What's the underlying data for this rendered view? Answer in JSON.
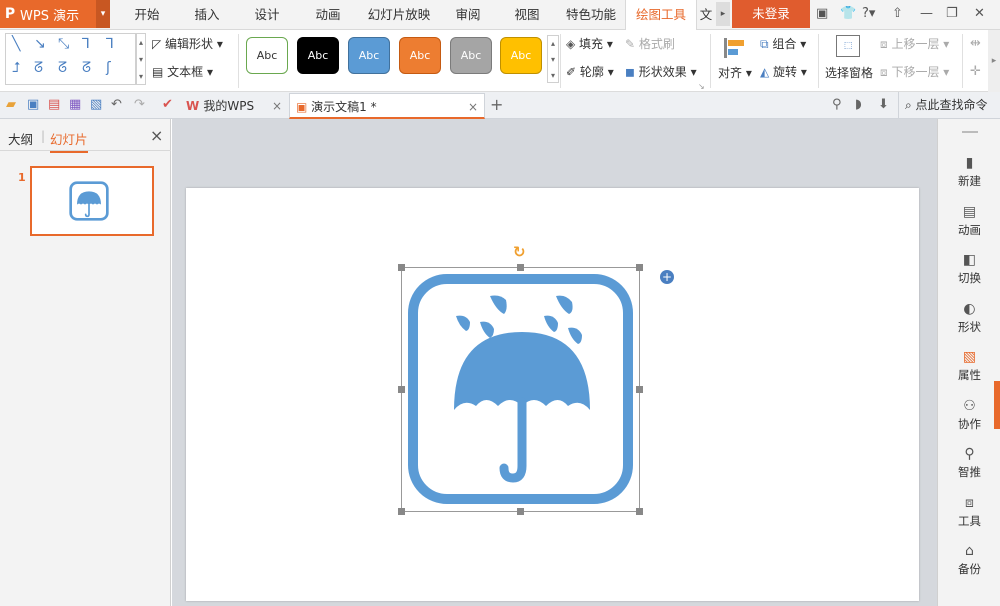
{
  "app": {
    "logo": "P",
    "name": "WPS 演示",
    "dropdown": "▾"
  },
  "menu": {
    "tabs": [
      "开始",
      "插入",
      "设计",
      "动画",
      "幻灯片放映",
      "审阅",
      "视图",
      "特色功能",
      "绘图工具",
      "文"
    ],
    "active": "绘图工具",
    "login": "未登录",
    "help": "?",
    "right_icons": [
      "archive-icon",
      "shirt-icon",
      "help-icon",
      "upload-icon",
      "minimize-icon",
      "restore-icon",
      "close-icon"
    ]
  },
  "ribbon": {
    "edit_shape": "编辑形状",
    "text_box": "文本框",
    "style_samples": [
      {
        "label": "Abc",
        "bg": "#ffffff",
        "fg": "#333333",
        "border": "#6aa84f"
      },
      {
        "label": "Abc",
        "bg": "#000000",
        "fg": "#ffffff",
        "border": "#000000"
      },
      {
        "label": "Abc",
        "bg": "#5b9bd5",
        "fg": "#ffffff",
        "border": "#41719c"
      },
      {
        "label": "Abc",
        "bg": "#ed7d31",
        "fg": "#ffffff",
        "border": "#c55a11"
      },
      {
        "label": "Abc",
        "bg": "#a5a5a5",
        "fg": "#ffffff",
        "border": "#7b7b7b"
      },
      {
        "label": "Abc",
        "bg": "#ffc000",
        "fg": "#ffffff",
        "border": "#bf9000"
      }
    ],
    "fill": "填充",
    "format_painter": "格式刷",
    "outline": "轮廓",
    "shape_effects": "形状效果",
    "align": "对齐",
    "group": "组合",
    "rotate": "旋转",
    "selection_pane": "选择窗格",
    "bring_forward": "上移一层",
    "send_backward": "下移一层"
  },
  "quickbar": {
    "doc_tabs": [
      {
        "label": "我的WPS",
        "close": "×"
      },
      {
        "label": "演示文稿1 *",
        "close": "×"
      }
    ],
    "add_tab": "+",
    "search": "点此查找命令"
  },
  "left_panel": {
    "tab_outline": "大纲",
    "tab_slides": "幻灯片",
    "close": "×",
    "slide_number": "1"
  },
  "right_panel": {
    "items": [
      {
        "label": "新建",
        "icon": "new-doc-icon"
      },
      {
        "label": "动画",
        "icon": "animation-icon"
      },
      {
        "label": "切换",
        "icon": "transition-icon"
      },
      {
        "label": "形状",
        "icon": "shape-icon"
      },
      {
        "label": "属性",
        "icon": "properties-icon"
      },
      {
        "label": "协作",
        "icon": "collaborate-icon"
      },
      {
        "label": "智推",
        "icon": "smart-icon"
      },
      {
        "label": "工具",
        "icon": "tools-icon"
      },
      {
        "label": "备份",
        "icon": "backup-icon"
      }
    ]
  },
  "colors": {
    "accent": "#e8692b",
    "icon_blue": "#5b9bd5"
  }
}
